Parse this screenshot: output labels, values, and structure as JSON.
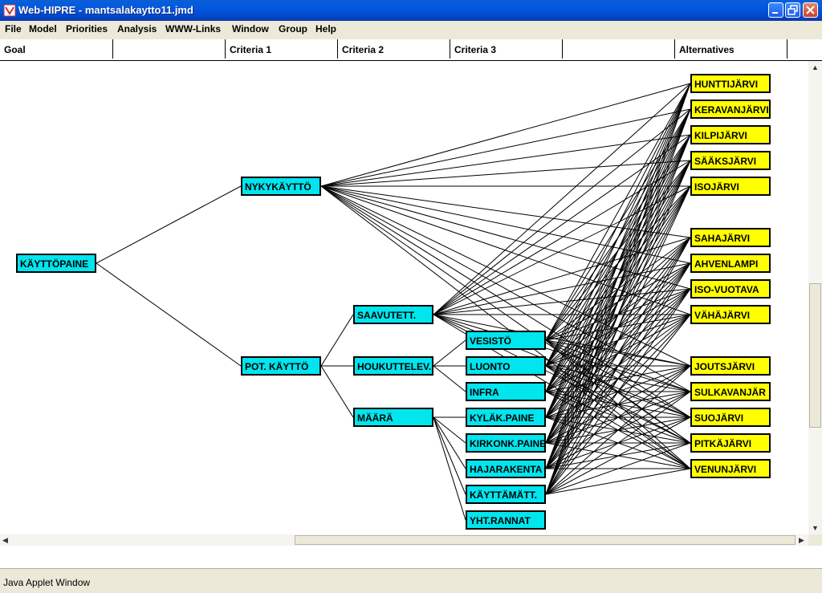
{
  "window": {
    "title": "Web-HIPRE - mantsalakaytto11.jmd"
  },
  "menu": [
    "File",
    "Model",
    "Priorities",
    "Analysis",
    "WWW-Links",
    "Window",
    "Group",
    "Help"
  ],
  "columns": [
    "Goal",
    "",
    "Criteria 1",
    "Criteria 2",
    "Criteria 3",
    "",
    "Alternatives",
    ""
  ],
  "goal": {
    "label": "KÄYTTÖPAINE"
  },
  "criteria1": [
    {
      "label": "NYKYKÄYTTÖ"
    },
    {
      "label": "POT. KÄYTTÖ"
    }
  ],
  "criteria2": [
    {
      "label": "SAAVUTETT."
    },
    {
      "label": "HOUKUTTELEV."
    },
    {
      "label": "MÄÄRÄ"
    }
  ],
  "criteria3": [
    {
      "label": "VESISTÖ"
    },
    {
      "label": "LUONTO"
    },
    {
      "label": "INFRA"
    },
    {
      "label": "KYLÄK.PAINE"
    },
    {
      "label": "KIRKONK.PAINE"
    },
    {
      "label": "HAJARAKENTA"
    },
    {
      "label": "KÄYTTÄMÄTT."
    },
    {
      "label": "YHT.RANNAT"
    }
  ],
  "alternatives": [
    {
      "label": "HUNTTIJÄRVI"
    },
    {
      "label": "KERAVANJÄRVI"
    },
    {
      "label": "KILPIJÄRVI"
    },
    {
      "label": "SÄÄKSJÄRVI"
    },
    {
      "label": "ISOJÄRVI"
    },
    {
      "label": "SAHAJÄRVI"
    },
    {
      "label": "AHVENLAMPI"
    },
    {
      "label": "ISO-VUOTAVA"
    },
    {
      "label": "VÄHÄJÄRVI"
    },
    {
      "label": "JOUTSJÄRVI"
    },
    {
      "label": "SULKAVANJÄR"
    },
    {
      "label": "SUOJÄRVI"
    },
    {
      "label": "PITKÄJÄRVI"
    },
    {
      "label": "VENUNJÄRVI"
    }
  ],
  "statusbar": {
    "text": "Java Applet Window"
  },
  "colors": {
    "criteria": "#00e5ee",
    "alternative": "#ffff00"
  },
  "icons": {
    "app": "hipre-app-icon",
    "minimize": "minimize-icon",
    "maximize": "restore-icon",
    "close": "close-icon"
  }
}
